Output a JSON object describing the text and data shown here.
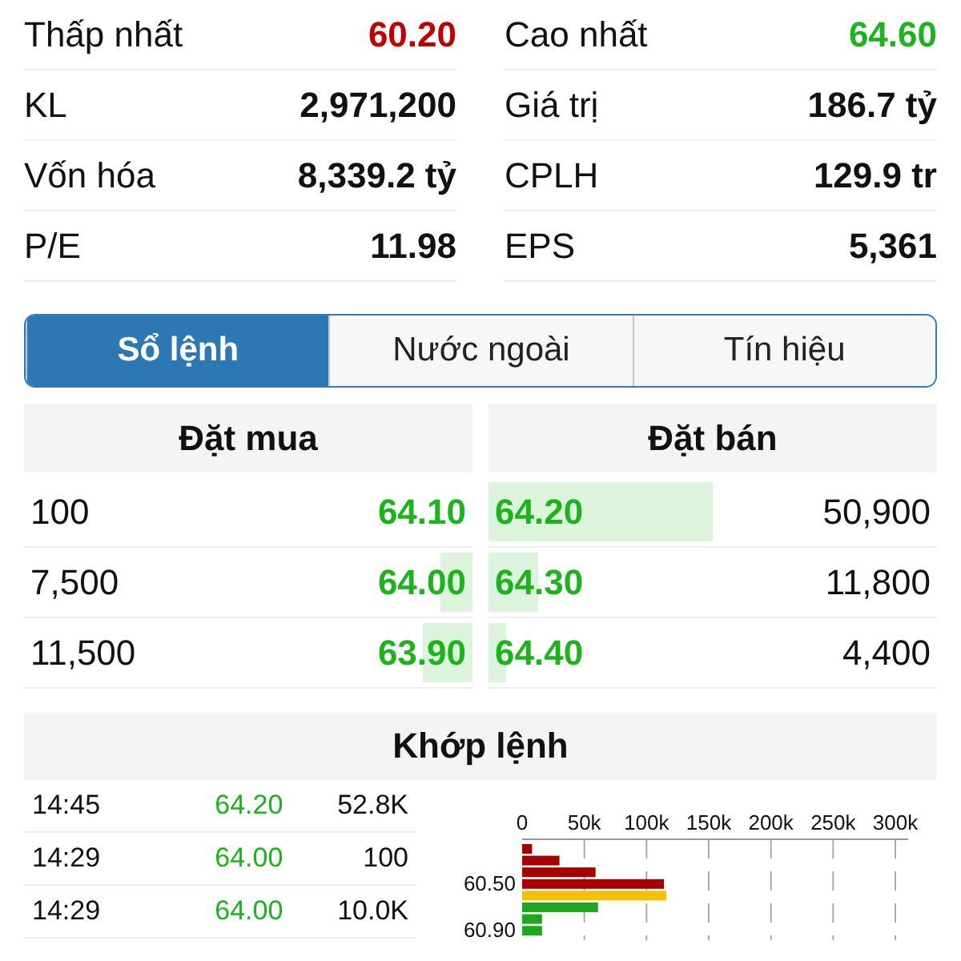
{
  "stats": [
    {
      "label": "Thấp nhất",
      "value": "60.20",
      "color": "#c00000"
    },
    {
      "label": "Cao nhất",
      "value": "64.60",
      "color": "#1db31d"
    },
    {
      "label": "KL",
      "value": "2,971,200",
      "color": "#111111"
    },
    {
      "label": "Giá trị",
      "value": "186.7 tỷ",
      "color": "#111111"
    },
    {
      "label": "Vốn hóa",
      "value": "8,339.2 tỷ",
      "color": "#111111"
    },
    {
      "label": "CPLH",
      "value": "129.9 tr",
      "color": "#111111"
    },
    {
      "label": "P/E",
      "value": "11.98",
      "color": "#111111"
    },
    {
      "label": "EPS",
      "value": "5,361",
      "color": "#111111"
    }
  ],
  "tabs": [
    {
      "label": "Sổ lệnh",
      "selected": true
    },
    {
      "label": "Nước ngoài",
      "selected": false
    },
    {
      "label": "Tín hiệu",
      "selected": false
    }
  ],
  "order_book": {
    "bid_title": "Đặt mua",
    "ask_title": "Đặt bán",
    "rows": [
      {
        "bid": {
          "volume": "100",
          "price": "64.10",
          "level": 0
        },
        "ask": {
          "price": "64.20",
          "level": 0.5,
          "volume": "50,900"
        }
      },
      {
        "bid": {
          "volume": "7,500",
          "price": "64.00",
          "level": 0.07
        },
        "ask": {
          "price": "64.30",
          "level": 0.11,
          "volume": "11,800"
        }
      },
      {
        "bid": {
          "volume": "11,500",
          "price": "63.90",
          "level": 0.11
        },
        "ask": {
          "price": "64.40",
          "level": 0.04,
          "volume": "4,400"
        }
      }
    ]
  },
  "matched": {
    "title": "Khớp lệnh",
    "trades": [
      {
        "time": "14:45",
        "price": "64.20",
        "volume": "52.8K"
      },
      {
        "time": "14:29",
        "price": "64.00",
        "volume": "100"
      },
      {
        "time": "14:29",
        "price": "64.00",
        "volume": "10.0K"
      }
    ],
    "volume_axis_labels": [
      "0",
      "50k",
      "100k",
      "150k",
      "200k",
      "250k",
      "300k"
    ],
    "price_labels": [
      "60.50",
      "60.90"
    ]
  }
}
